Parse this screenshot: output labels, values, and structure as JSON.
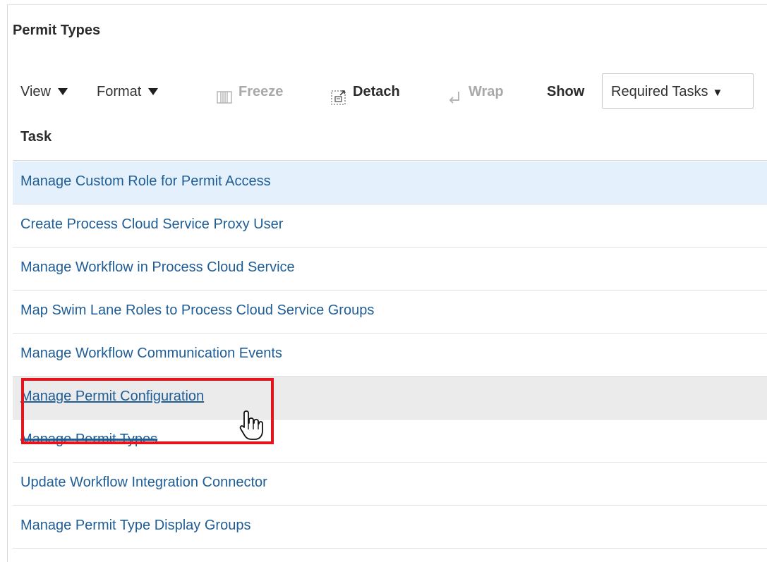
{
  "panel": {
    "title": "Permit Types"
  },
  "toolbar": {
    "view_label": "View",
    "format_label": "Format",
    "freeze_label": "Freeze",
    "detach_label": "Detach",
    "wrap_label": "Wrap",
    "show_label": "Show",
    "show_select_value": "Required Tasks",
    "select_caret": "▼"
  },
  "table": {
    "column_header": "Task",
    "rows": [
      {
        "label": "Manage Custom Role for Permit Access",
        "state": "selected"
      },
      {
        "label": "Create Process Cloud Service Proxy User",
        "state": "normal"
      },
      {
        "label": "Manage Workflow in Process Cloud Service",
        "state": "normal"
      },
      {
        "label": "Map Swim Lane Roles to Process Cloud Service Groups",
        "state": "normal"
      },
      {
        "label": "Manage Workflow Communication Events",
        "state": "normal"
      },
      {
        "label": "Manage Permit Configuration",
        "state": "hover"
      },
      {
        "label": "Manage Permit Types",
        "state": "obscured"
      },
      {
        "label": "Update Workflow Integration Connector",
        "state": "normal"
      },
      {
        "label": "Manage Permit Type Display Groups",
        "state": "normal"
      }
    ]
  },
  "annotation": {
    "highlight_color": "#e3141b",
    "cursor_icon": "hand-pointer-icon"
  },
  "colors": {
    "link": "#1f5d96",
    "selected_row": "#e4f0fb",
    "hover_row": "#ebebeb",
    "disabled_text": "#a9a9a9"
  }
}
